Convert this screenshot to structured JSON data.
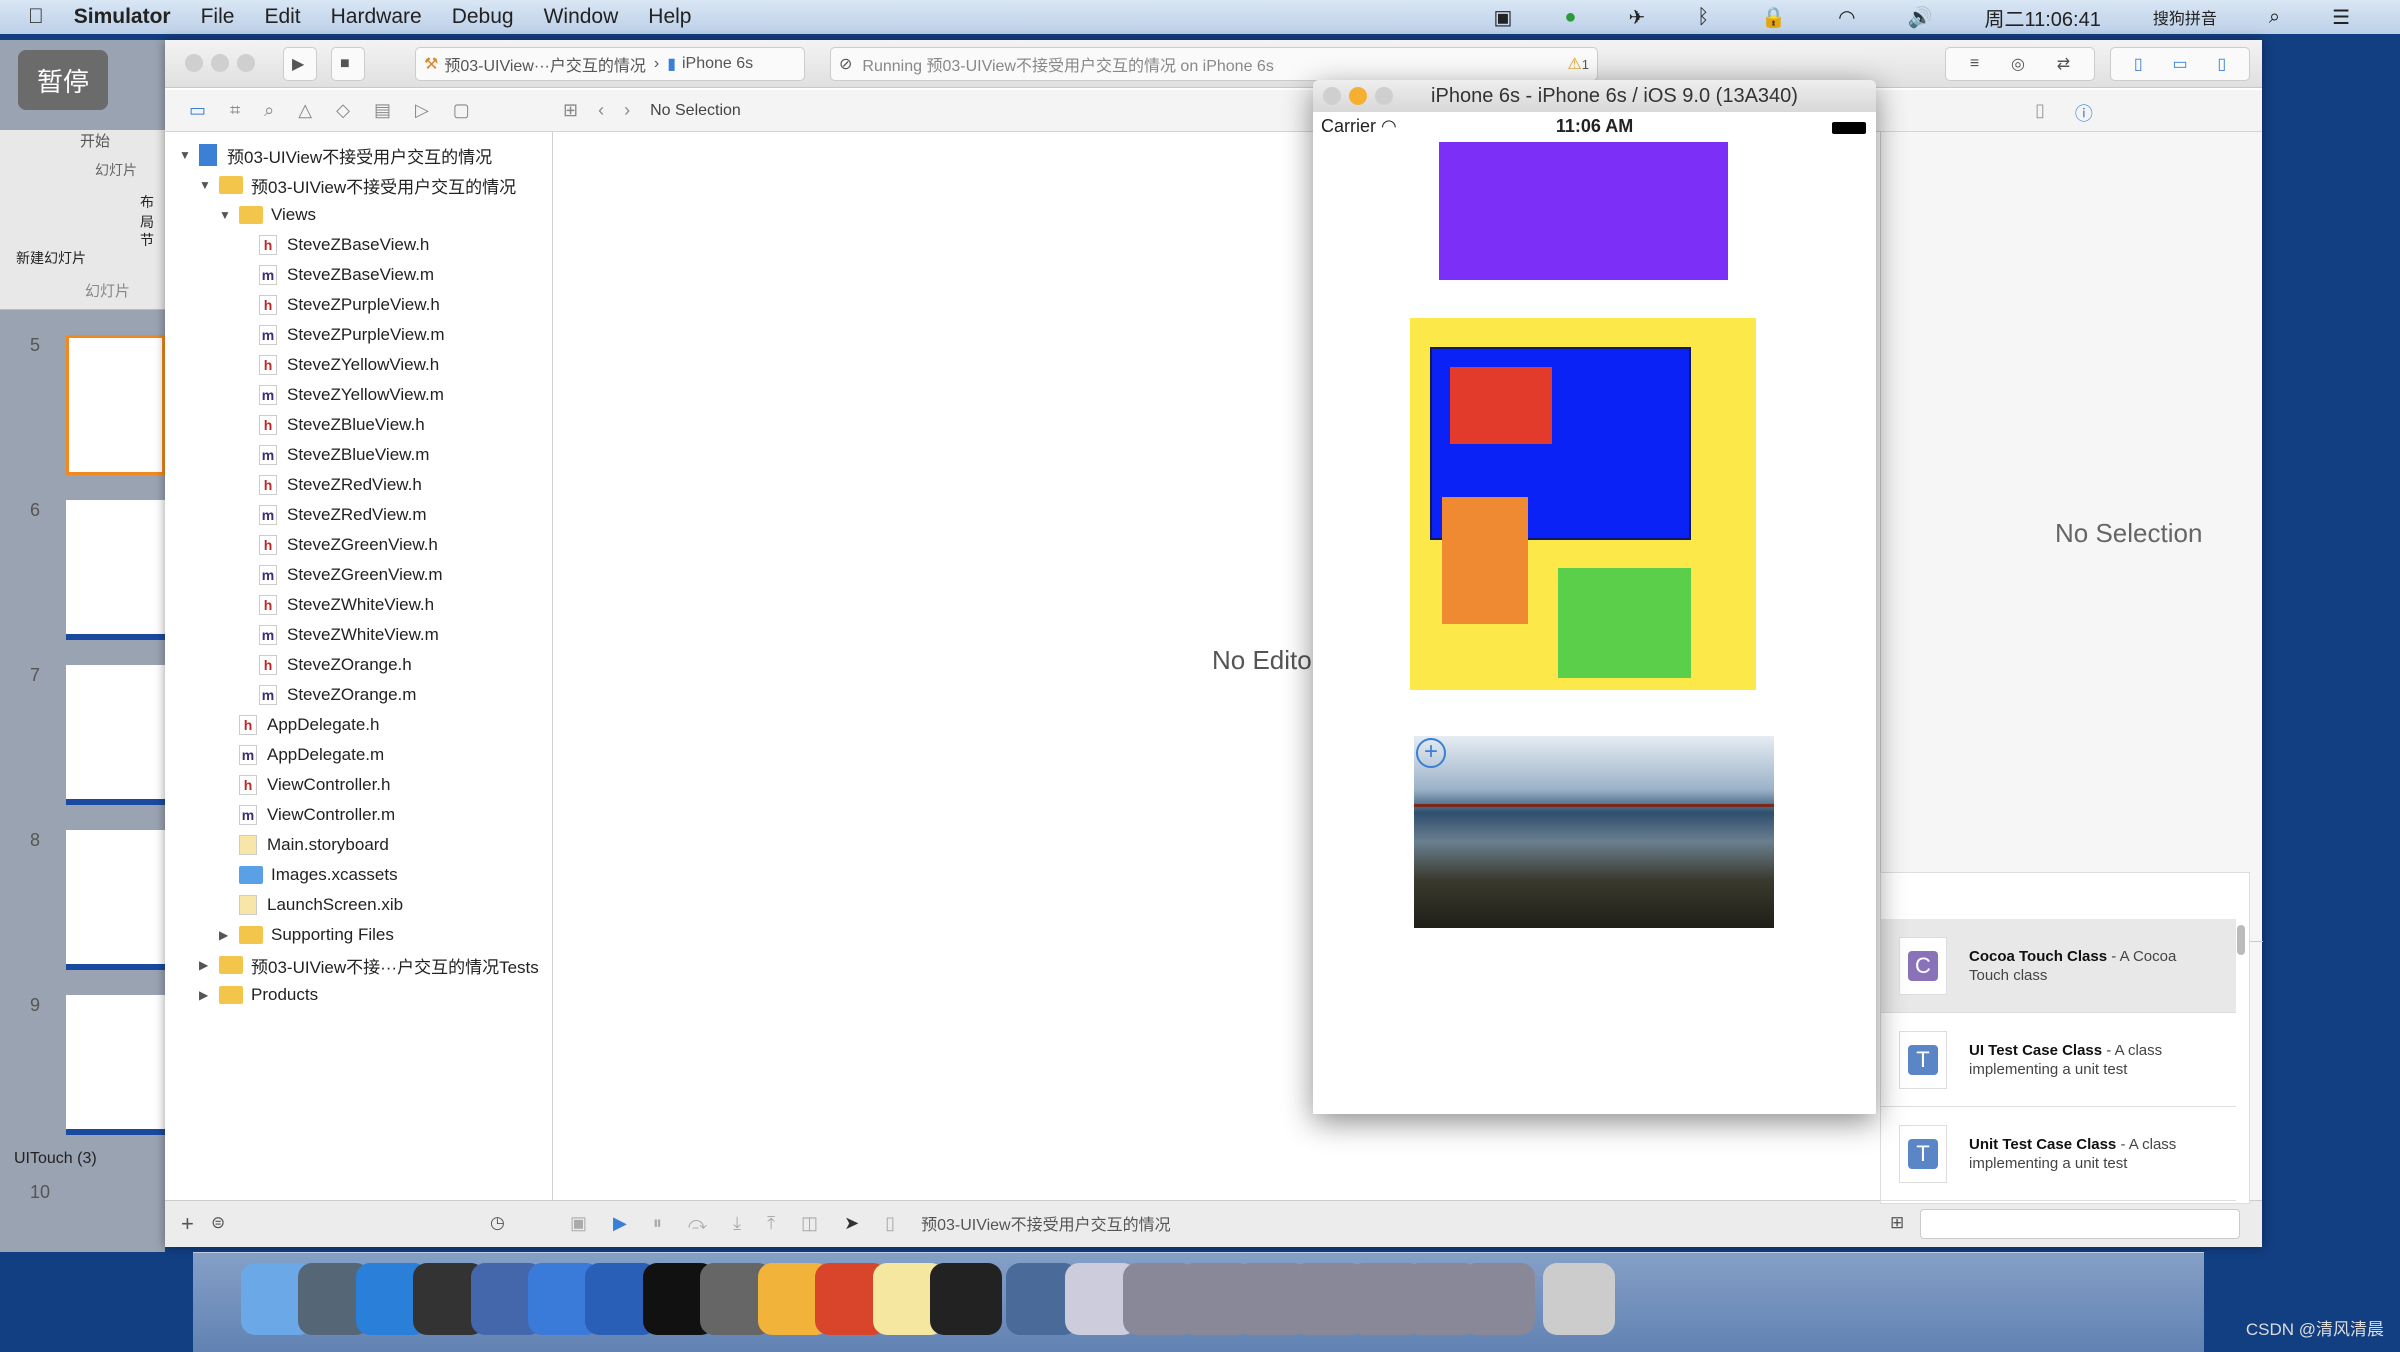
{
  "menubar": {
    "app": "Simulator",
    "items": [
      "File",
      "Edit",
      "Hardware",
      "Debug",
      "Window",
      "Help"
    ],
    "clock": "周二11:06:41",
    "ime": "搜狗拼音"
  },
  "keynote": {
    "pause": "暂停",
    "tab_home": "开始",
    "group": "幻灯片",
    "new_slide": "新建幻灯片",
    "layout": "布局",
    "section": "节",
    "panel_tab": "幻灯片",
    "slide_numbers": [
      "5",
      "6",
      "7",
      "8",
      "9",
      "10"
    ],
    "section_label": "UITouch (3)"
  },
  "toolbar": {
    "scheme": "预03-UIView···户交互的情况",
    "device": "iPhone 6s",
    "status": "Running 预03-UIView不接受用户交互的情况 on iPhone 6s",
    "warnings": "1"
  },
  "navbar": {
    "jump": "No Selection"
  },
  "navigator": {
    "items": [
      {
        "label": "预03-UIView不接受用户交互的情况",
        "type": "project",
        "level": 0,
        "open": true
      },
      {
        "label": "预03-UIView不接受用户交互的情况",
        "type": "folder",
        "level": 1,
        "open": true
      },
      {
        "label": "Views",
        "type": "folder",
        "level": 2,
        "open": true
      },
      {
        "label": "SteveZBaseView.h",
        "type": "h",
        "level": 3
      },
      {
        "label": "SteveZBaseView.m",
        "type": "m",
        "level": 3
      },
      {
        "label": "SteveZPurpleView.h",
        "type": "h",
        "level": 3
      },
      {
        "label": "SteveZPurpleView.m",
        "type": "m",
        "level": 3
      },
      {
        "label": "SteveZYellowView.h",
        "type": "h",
        "level": 3
      },
      {
        "label": "SteveZYellowView.m",
        "type": "m",
        "level": 3
      },
      {
        "label": "SteveZBlueView.h",
        "type": "h",
        "level": 3
      },
      {
        "label": "SteveZBlueView.m",
        "type": "m",
        "level": 3
      },
      {
        "label": "SteveZRedView.h",
        "type": "h",
        "level": 3
      },
      {
        "label": "SteveZRedView.m",
        "type": "m",
        "level": 3
      },
      {
        "label": "SteveZGreenView.h",
        "type": "h",
        "level": 3
      },
      {
        "label": "SteveZGreenView.m",
        "type": "m",
        "level": 3
      },
      {
        "label": "SteveZWhiteView.h",
        "type": "h",
        "level": 3
      },
      {
        "label": "SteveZWhiteView.m",
        "type": "m",
        "level": 3
      },
      {
        "label": "SteveZOrange.h",
        "type": "h",
        "level": 3
      },
      {
        "label": "SteveZOrange.m",
        "type": "m",
        "level": 3
      },
      {
        "label": "AppDelegate.h",
        "type": "h",
        "level": 2
      },
      {
        "label": "AppDelegate.m",
        "type": "m",
        "level": 2
      },
      {
        "label": "ViewController.h",
        "type": "h",
        "level": 2
      },
      {
        "label": "ViewController.m",
        "type": "m",
        "level": 2
      },
      {
        "label": "Main.storyboard",
        "type": "storyboard",
        "level": 2
      },
      {
        "label": "Images.xcassets",
        "type": "assets",
        "level": 2
      },
      {
        "label": "LaunchScreen.xib",
        "type": "storyboard",
        "level": 2
      },
      {
        "label": "Supporting Files",
        "type": "folder",
        "level": 2,
        "open": false
      },
      {
        "label": "预03-UIView不接···户交互的情况Tests",
        "type": "folder",
        "level": 1,
        "open": false
      },
      {
        "label": "Products",
        "type": "folder",
        "level": 1,
        "open": false
      }
    ]
  },
  "editor": {
    "empty": "No Editor"
  },
  "inspector": {
    "empty": "No Selection"
  },
  "library": {
    "items": [
      {
        "title": "Cocoa Touch Class",
        "desc": " - A Cocoa Touch class",
        "letter": "C",
        "color": "#8a72b8"
      },
      {
        "title": "UI Test Case Class",
        "desc": " - A class implementing a unit test",
        "letter": "T",
        "color": "#5a86c8"
      },
      {
        "title": "Unit Test Case Class",
        "desc": " - A class implementing a unit test",
        "letter": "T",
        "color": "#5a86c8"
      }
    ]
  },
  "debugbar": {
    "target": "预03-UIView不接受用户交互的情况"
  },
  "simulator": {
    "title": "iPhone 6s - iPhone 6s / iOS 9.0 (13A340)",
    "carrier": "Carrier",
    "time": "11:06 AM",
    "colors": {
      "purple": "#7b2ff7",
      "yellow": "#fde84a",
      "blue": "#0a22f5",
      "red": "#e23a2b",
      "orange": "#ef8a32",
      "green": "#5ccf4a"
    }
  },
  "dock": {
    "apps": [
      "Finder",
      "Launchpad",
      "Safari",
      "Mouse",
      "Keynote Movie",
      "Xcode",
      "Instruments",
      "Terminal",
      "System Preferences",
      "Sketch",
      "PowerPoint",
      "Notes",
      "Console",
      "QuickTime",
      "Preview",
      "Window 1",
      "Window 2",
      "Window 3",
      "Window 4",
      "Window 5",
      "Window 6",
      "Window 7",
      "Trash"
    ]
  },
  "watermark": "CSDN @清风清晨"
}
